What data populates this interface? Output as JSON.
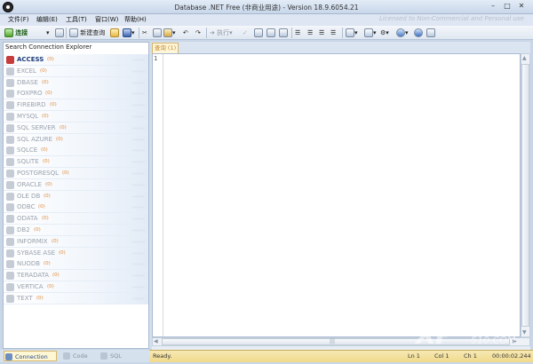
{
  "window": {
    "title": "Database .NET Free (非商业用途) - Version 18.9.6054.21",
    "license_notice": "Licensed to Non-Commercial and Personal use"
  },
  "menu": [
    "文件(F)",
    "编辑(E)",
    "工具(T)",
    "窗口(W)",
    "帮助(H)"
  ],
  "toolbar": {
    "connect_label": "连接",
    "new_query_label": "新建查询",
    "execute_label": "执行"
  },
  "explorer": {
    "search_label": "Search Connection Explorer",
    "connections": [
      {
        "name": "ACCESS",
        "count": "(0)"
      },
      {
        "name": "EXCEL",
        "count": "(0)"
      },
      {
        "name": "DBASE",
        "count": "(0)"
      },
      {
        "name": "FOXPRO",
        "count": "(0)"
      },
      {
        "name": "FIREBIRD",
        "count": "(0)"
      },
      {
        "name": "MYSQL",
        "count": "(0)"
      },
      {
        "name": "SQL SERVER",
        "count": "(0)"
      },
      {
        "name": "SQL AZURE",
        "count": "(0)"
      },
      {
        "name": "SQLCE",
        "count": "(0)"
      },
      {
        "name": "SQLITE",
        "count": "(0)"
      },
      {
        "name": "POSTGRESQL",
        "count": "(0)"
      },
      {
        "name": "ORACLE",
        "count": "(0)"
      },
      {
        "name": "OLE DB",
        "count": "(0)"
      },
      {
        "name": "ODBC",
        "count": "(0)"
      },
      {
        "name": "ODATA",
        "count": "(0)"
      },
      {
        "name": "DB2",
        "count": "(0)"
      },
      {
        "name": "INFORMIX",
        "count": "(0)"
      },
      {
        "name": "SYBASE ASE",
        "count": "(0)"
      },
      {
        "name": "NUODB",
        "count": "(0)"
      },
      {
        "name": "TERADATA",
        "count": "(0)"
      },
      {
        "name": "VERTICA",
        "count": "(0)"
      },
      {
        "name": "TEXT",
        "count": "(0)"
      }
    ],
    "row_watermark": "‹‹‹‹‹‹‹"
  },
  "editor": {
    "tab_label": "查询 (1)",
    "line_number": "1",
    "hscroll_grip": "|||"
  },
  "bottom_tabs": [
    "Connection",
    "Code",
    "SQL"
  ],
  "status": {
    "text": "Ready.",
    "line": "Ln 1",
    "col": "Col 1",
    "ch": "Ch 1",
    "elapsed": "00:00:02.244"
  },
  "watermark": {
    "big": "XP",
    "site_cn": "系统之家",
    "site": "510.COM"
  }
}
